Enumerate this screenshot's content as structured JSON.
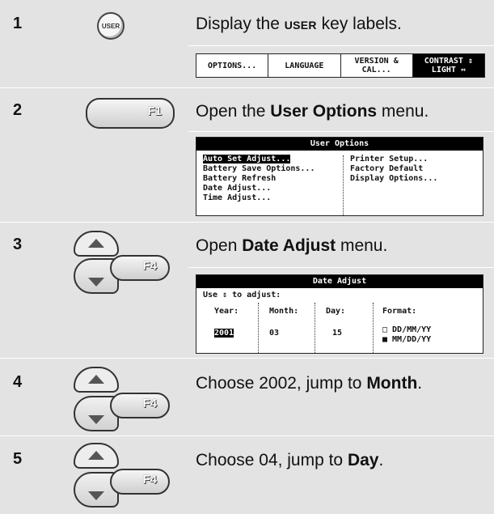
{
  "steps": [
    {
      "number": "1",
      "instruction": "Display the USER key labels."
    },
    {
      "number": "2",
      "instruction": "Open the User Options menu."
    },
    {
      "number": "3",
      "instruction": "Open Date Adjust menu."
    },
    {
      "number": "4",
      "instruction": "Choose 2002, jump to Month."
    },
    {
      "number": "5",
      "instruction": "Choose 04, jump to Day."
    }
  ],
  "step1": {
    "pre": "Display the ",
    "key": "USER",
    "post": " key labels."
  },
  "step2": {
    "pre": "Open the ",
    "bold": "User Options",
    "post": " menu."
  },
  "step3": {
    "pre": "Open ",
    "bold": "Date Adjust",
    "post": " menu."
  },
  "step4": {
    "pre": "Choose 2002, jump to ",
    "bold": "Month",
    "post": "."
  },
  "step5": {
    "pre": "Choose 04, jump to ",
    "bold": "Day",
    "post": "."
  },
  "keys": {
    "user": "USER",
    "f1": "F1",
    "f4": "F4"
  },
  "softkeys": [
    "OPTIONS...",
    "LANGUAGE",
    "VERSION & CAL...",
    "CONTRAST ⇕ LIGHT ⇔"
  ],
  "user_options": {
    "title": "User Options",
    "left": [
      "Auto Set Adjust...",
      "Battery Save Options...",
      "Battery Refresh",
      "Date Adjust...",
      "Time Adjust..."
    ],
    "right": [
      "Printer Setup...",
      "Factory Default",
      "Display Options..."
    ]
  },
  "date_adjust": {
    "title": "Date Adjust",
    "hint": "Use ⇕ to adjust:",
    "headers": [
      "Year:",
      "Month:",
      "Day:",
      "Format:"
    ],
    "values": [
      "2001",
      "03",
      "15"
    ],
    "formats": [
      "□ DD/MM/YY",
      "■ MM/DD/YY"
    ]
  }
}
